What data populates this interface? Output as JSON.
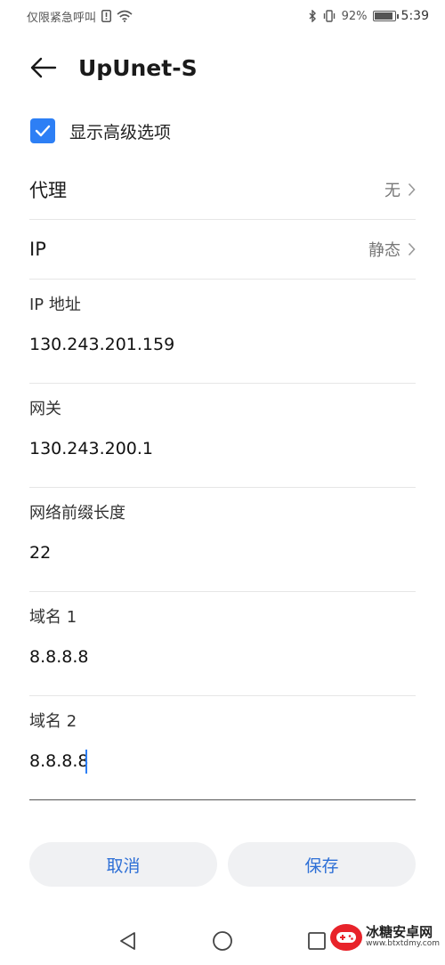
{
  "status_bar": {
    "carrier": "仅限紧急呼叫",
    "battery": "92%",
    "battery_level": 0.92,
    "time": "5:39"
  },
  "header": {
    "title": "UpUnet-S"
  },
  "advanced_option": {
    "label": "显示高级选项",
    "checked": true
  },
  "proxy": {
    "label": "代理",
    "value": "无"
  },
  "ip_mode": {
    "label": "IP",
    "value": "静态"
  },
  "fields": [
    {
      "label": "IP 地址",
      "value": "130.243.201.159"
    },
    {
      "label": "网关",
      "value": "130.243.200.1"
    },
    {
      "label": "网络前缀长度",
      "value": "22"
    },
    {
      "label": "域名 1",
      "value": "8.8.8.8"
    },
    {
      "label": "域名 2",
      "value": "8.8.8.8"
    }
  ],
  "buttons": {
    "cancel": "取消",
    "save": "保存"
  },
  "watermark": {
    "name": "冰糖安卓网",
    "url": "www.btxtdmy.com"
  },
  "colors": {
    "accent": "#2d7ff5",
    "button_text": "#2d6fd6",
    "button_bg": "#f0f1f3"
  }
}
